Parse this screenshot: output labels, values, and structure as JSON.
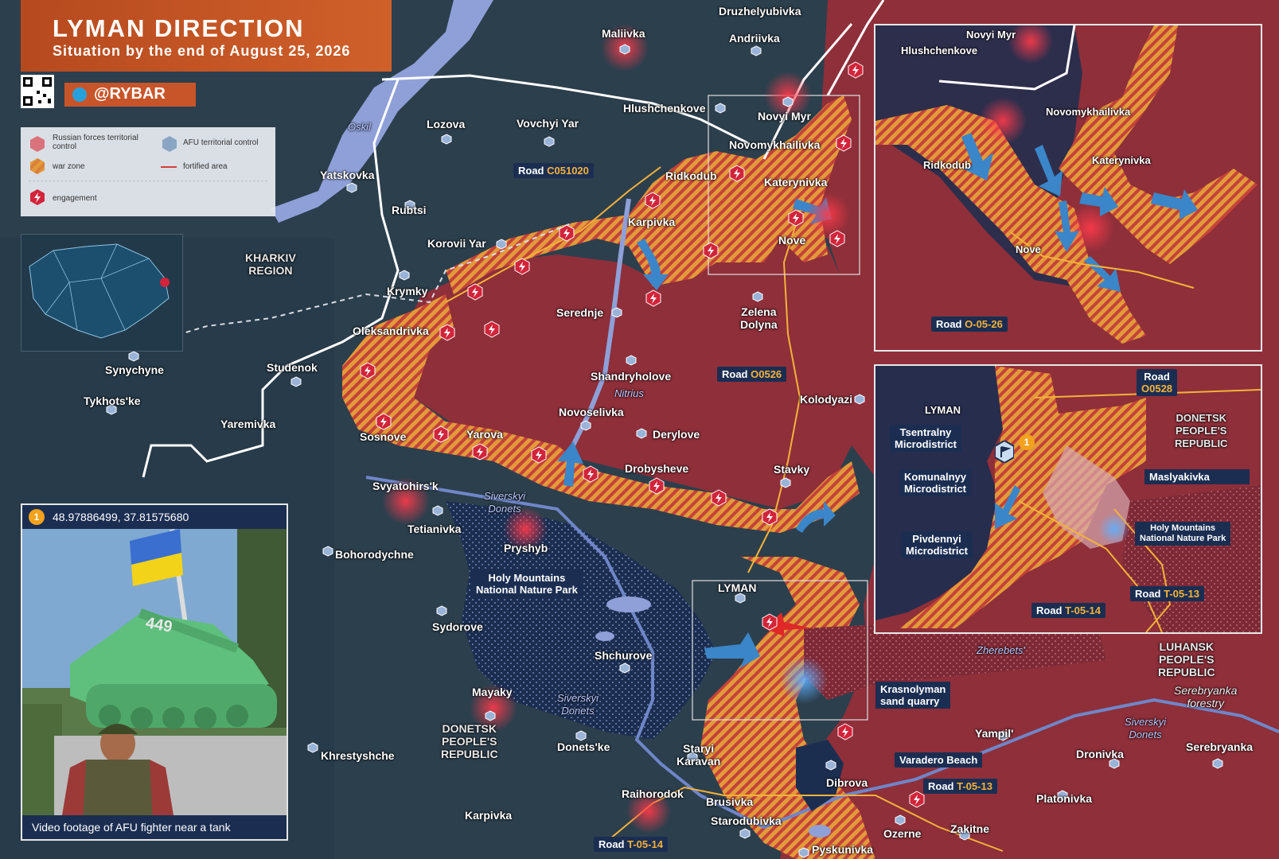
{
  "header": {
    "title": "LYMAN DIRECTION",
    "subtitle": "Situation by the end of August 25, 2026",
    "brand": "@RYBAR"
  },
  "legend": {
    "russian": "Russian forces territorial control",
    "afu": "AFU territorial control",
    "war_zone": "war zone",
    "fortified": "fortified area",
    "engagement": "engagement"
  },
  "colors": {
    "russian": "#8e2f3a",
    "afu_dark": "#1c2e50",
    "war_zone_orange": "#e39a3a",
    "war_zone_red": "#c4423a",
    "water": "#8fa0d8",
    "header": "#c9592a",
    "label_bg": "#1b2e52",
    "road_code": "#f4b23a",
    "engagement": "#d2243a",
    "arrow_blue": "#3a86c8",
    "arrow_red": "#e02828"
  },
  "icons": [
    "telegram-icon",
    "qr-code-icon",
    "engagement-icon",
    "settlement-marker-icon",
    "afu-flag-icon",
    "advance-arrow-icon"
  ],
  "photo": {
    "badge": "1",
    "coords": "48.97886499, 37.81575680",
    "caption": "Video footage of AFU fighter near a tank",
    "tank_number": "449"
  },
  "regions": {
    "kharkiv": "KHARKIV\nREGION",
    "donetsk": "DONETSK\nPEOPLE'S\nREPUBLIC",
    "luhansk": "LUHANSK\nPEOPLE'S\nREPUBLIC"
  },
  "water": {
    "oskil": "Oskil",
    "nitrius": "Nitrius",
    "siverskyi_donets": "Siverskyi\nDonets",
    "zherebets": "Zherebets'"
  },
  "settlements": {
    "druzhelyubivka": "Druzhelyubivka",
    "maliivka": "Maliivka",
    "andriivka": "Andriivka",
    "hlushchenkove": "Hlushchenkove",
    "novyi_myr": "Novyi Myr",
    "novomykhailivka": "Novomykhailivka",
    "lozova": "Lozova",
    "vovchyi_yar": "Vovchyi Yar",
    "yatskovka": "Yatskovka",
    "rubtsi": "Rubtsi",
    "ridkodub": "Ridkodub",
    "katerynivka": "Katerynivka",
    "karpivka": "Karpivka",
    "korovii_yar": "Korovii Yar",
    "nove": "Nove",
    "krymky": "Krymky",
    "serednje": "Serednje",
    "zelena_dolyna": "Zelena\nDolyna",
    "oleksandrivka": "Oleksandrivka",
    "synychyne": "Synychyne",
    "studenok": "Studenok",
    "shandryholove": "Shandryholove",
    "kolodyazi": "Kolodyazi",
    "tykhotske": "Tykhots'ke",
    "yaremivka": "Yaremivka",
    "novoselivka": "Novoselivka",
    "sosnove": "Sosnove",
    "yarova": "Yarova",
    "derylove": "Derylove",
    "drobysheve": "Drobysheve",
    "stavky": "Stavky",
    "svyatohirsk": "Svyatohirs'k",
    "tetianivka": "Tetianivka",
    "pryshyb": "Pryshyb",
    "bohorodychne": "Bohorodychne",
    "holy_mountains": "Holy Mountains\nNational Nature Park",
    "lyman": "LYMAN",
    "sydorove": "Sydorove",
    "shchurove": "Shchurove",
    "mayaky": "Mayaky",
    "khrestyshche": "Khrestyshche",
    "donetske": "Donets'ke",
    "staryi_karavan": "Staryi\nKaravan",
    "raihorodok": "Raihorodok",
    "brusivka": "Brusivka",
    "starodubivka": "Starodubivka",
    "karpivka_s": "Karpivka",
    "pyskunivka": "Pyskunivka",
    "dibrova": "Dibrova",
    "ozerne": "Ozerne",
    "zakitne": "Zakitne",
    "yampil": "Yampil'",
    "dronivka": "Dronivka",
    "platonivka": "Platonivka",
    "serebryanka": "Serebryanka",
    "serebryanka_forestry": "Serebryanka\nforestry"
  },
  "map_tags": {
    "krasnolyman": "Krasnolyman\nsand quarry",
    "varadero": "Varadero Beach"
  },
  "roads": {
    "road_word": "Road",
    "c051020": "C051020",
    "o0526": "O0526",
    "t0514": "T-05-14",
    "t0513": "T-05-13"
  },
  "inset_top": {
    "hlushchenkove": "Hlushchenkove",
    "novyi_myr": "Novyi Myr",
    "novomykhailivka": "Novomykhailivka",
    "ridkodub": "Ridkodub",
    "katerynivka": "Katerynivka",
    "nove": "Nove",
    "road_code": "O-05-26"
  },
  "inset_bottom": {
    "road_code_top": "O0528",
    "lyman": "LYMAN",
    "tsentralny": "Tsentralny\nMicrodistrict",
    "komunalnyy": "Komunalnyy\nMicrodistrict",
    "pivdennyi": "Pivdennyi\nMicrodistrict",
    "maslyakivka": "Maslyakivka",
    "holy_mountains": "Holy Mountains\nNational Nature Park",
    "dpr": "DONETSK\nPEOPLE'S\nREPUBLIC",
    "t0514": "T-05-14",
    "t0513": "T-05-13",
    "badge": "1"
  }
}
